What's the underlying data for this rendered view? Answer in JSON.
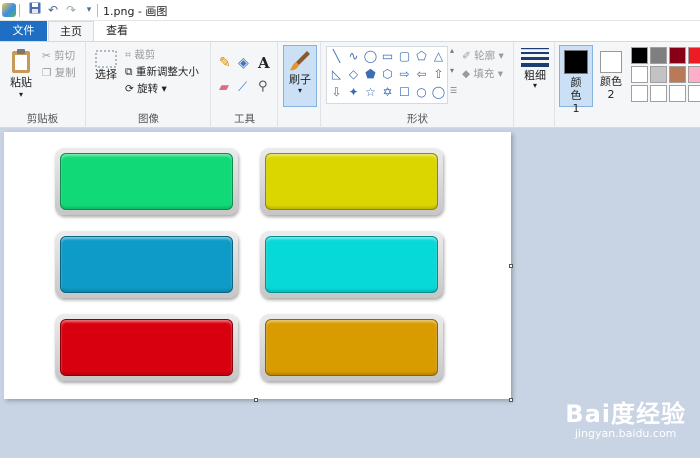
{
  "titlebar": {
    "title": "1.png - 画图"
  },
  "tabs": {
    "file": "文件",
    "home": "主页",
    "view": "查看"
  },
  "clipboard": {
    "paste": "粘贴",
    "cut": "剪切",
    "copy": "复制",
    "label": "剪贴板"
  },
  "image": {
    "select": "选择",
    "crop": "裁剪",
    "resize": "重新调整大小",
    "rotate": "旋转",
    "label": "图像"
  },
  "tools": {
    "label": "工具"
  },
  "brushes": {
    "label": "刷子"
  },
  "shapes": {
    "outline": "轮廓",
    "fill": "填充",
    "label": "形状",
    "items": [
      "╲",
      "∿",
      "◯",
      "▭",
      "▢",
      "⬠",
      "△",
      "◺",
      "◇",
      "⬟",
      "⬡",
      "⇨",
      "⇦",
      "⇧",
      "⇩",
      "✦",
      "☆",
      "✡",
      "☐",
      "○",
      "◯"
    ]
  },
  "size": {
    "label": "粗细"
  },
  "colors": {
    "color1": "颜色1",
    "color2": "颜色2",
    "color1_value": "#000000",
    "color2_value": "#ffffff",
    "palette": [
      "#000000",
      "#7f7f7f",
      "#880015",
      "#ed1c24",
      "#ffffff",
      "#c3c3c3",
      "#b97a57",
      "#ffaec9",
      "#ffffff",
      "#ffffff",
      "#ffffff",
      "#ffffff"
    ]
  },
  "canvas": {
    "buttons": [
      {
        "name": "green-button",
        "color": "#12d978"
      },
      {
        "name": "yellow-button",
        "color": "#dcd600"
      },
      {
        "name": "blue-button",
        "color": "#0e9bc7"
      },
      {
        "name": "cyan-button",
        "color": "#07d9d9"
      },
      {
        "name": "red-button",
        "color": "#d8000e"
      },
      {
        "name": "orange-button",
        "color": "#d99c00"
      }
    ]
  },
  "watermark": {
    "logo": "Bai度经验",
    "url": "jingyan.baidu.com"
  }
}
